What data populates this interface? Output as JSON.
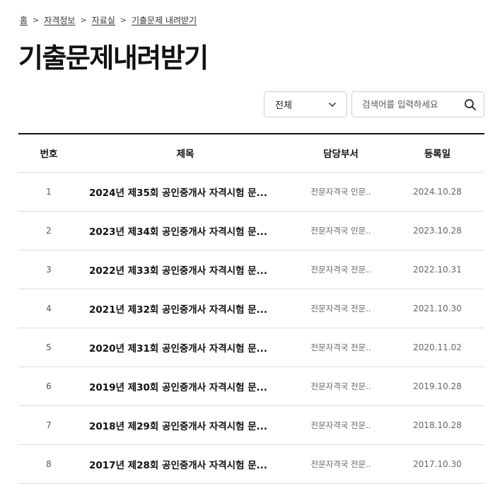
{
  "breadcrumb": [
    "홈",
    "자격정보",
    "자료실",
    "기출문제 내려받기"
  ],
  "page_title": "기출문제내려받기",
  "search": {
    "filter_selected": "전체",
    "placeholder": "검색어를 입력하세요"
  },
  "table": {
    "columns": [
      "번호",
      "제목",
      "담당부서",
      "등록일"
    ],
    "rows": [
      {
        "no": "1",
        "title": "2024년 제35회 공인중개사 자격시험 문...",
        "dept": "전문자격국 인문..",
        "date": "2024.10.28"
      },
      {
        "no": "2",
        "title": "2023년 제34회 공인중개사 자격시험 문...",
        "dept": "전문자격국 인문..",
        "date": "2023.10.28"
      },
      {
        "no": "3",
        "title": "2022년 제33회 공인중개사 자격시험 문...",
        "dept": "전문자격국 전문..",
        "date": "2022.10.31"
      },
      {
        "no": "4",
        "title": "2021년 제32회 공인중개사 자격시험 문...",
        "dept": "전문자격국 전문..",
        "date": "2021.10.30"
      },
      {
        "no": "5",
        "title": "2020년 제31회 공인중개사 자격시험 문...",
        "dept": "전문자격국 전문..",
        "date": "2020.11.02"
      },
      {
        "no": "6",
        "title": "2019년 제30회 공인중개사 자격시험 문...",
        "dept": "전문자격국 전문..",
        "date": "2019.10.28"
      },
      {
        "no": "7",
        "title": "2018년 제29회 공인중개사 자격시험 문...",
        "dept": "전문자격국 전문..",
        "date": "2018.10.28"
      },
      {
        "no": "8",
        "title": "2017년 제28회 공인중개사 자격시험 문...",
        "dept": "전문자격국 전문..",
        "date": "2017.10.30"
      }
    ]
  },
  "icons": {
    "home": "home-link",
    "dropdown": "chevron-down-icon",
    "search": "search-icon"
  }
}
